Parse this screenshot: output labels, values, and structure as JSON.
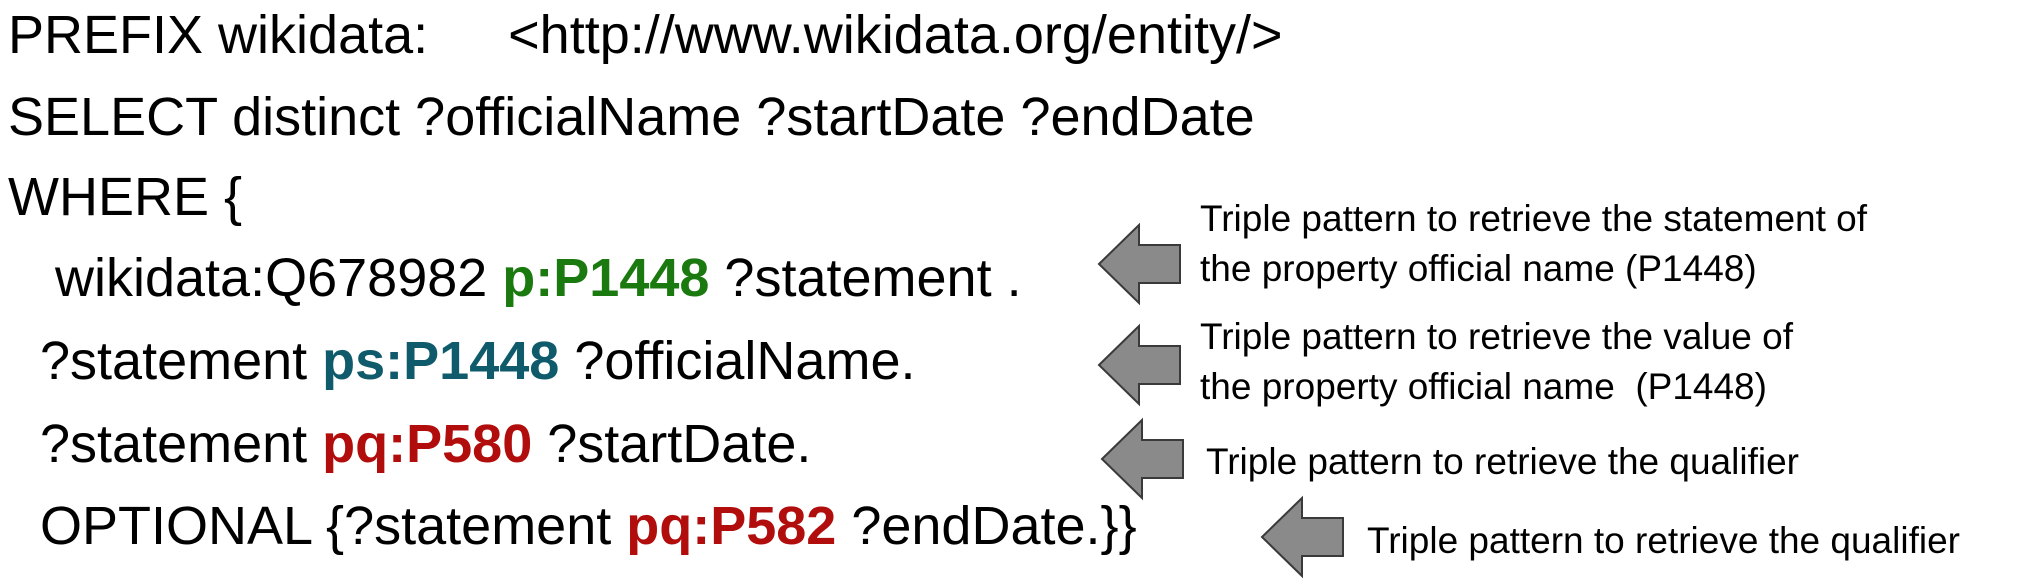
{
  "code": {
    "prefix_line": {
      "keyword": "PREFIX wikidata:",
      "iri": "<http://www.wikidata.org/entity/>"
    },
    "select_line": "SELECT distinct ?officialName ?startDate ?endDate",
    "where_line": "WHERE {",
    "triple1": {
      "subject": "wikidata:Q678982 ",
      "predicate": "p:P1448",
      "object": " ?statement ."
    },
    "triple2": {
      "subject": "?statement ",
      "predicate": "ps:P1448",
      "object": " ?officialName."
    },
    "triple3": {
      "subject": "?statement ",
      "predicate": "pq:P580",
      "object": " ?startDate."
    },
    "triple4": {
      "prefix": "OPTIONAL {?statement ",
      "predicate": "pq:P582",
      "object": " ?endDate.}}"
    }
  },
  "annotations": [
    {
      "line1": "Triple pattern to retrieve the statement of",
      "line2": "the property official name (P1448)"
    },
    {
      "line1": "Triple pattern to retrieve the value of",
      "line2": "the property official name  (P1448)"
    },
    {
      "line1": "Triple pattern to retrieve the qualifier"
    },
    {
      "line1": "Triple pattern to retrieve the qualifier"
    }
  ],
  "colors": {
    "p_prefix": "#1b7a0f",
    "ps_prefix": "#0f5a6b",
    "pq_prefix": "#b20d0d",
    "arrow_fill": "#8a8a8a",
    "arrow_stroke": "#3a3a3a"
  }
}
